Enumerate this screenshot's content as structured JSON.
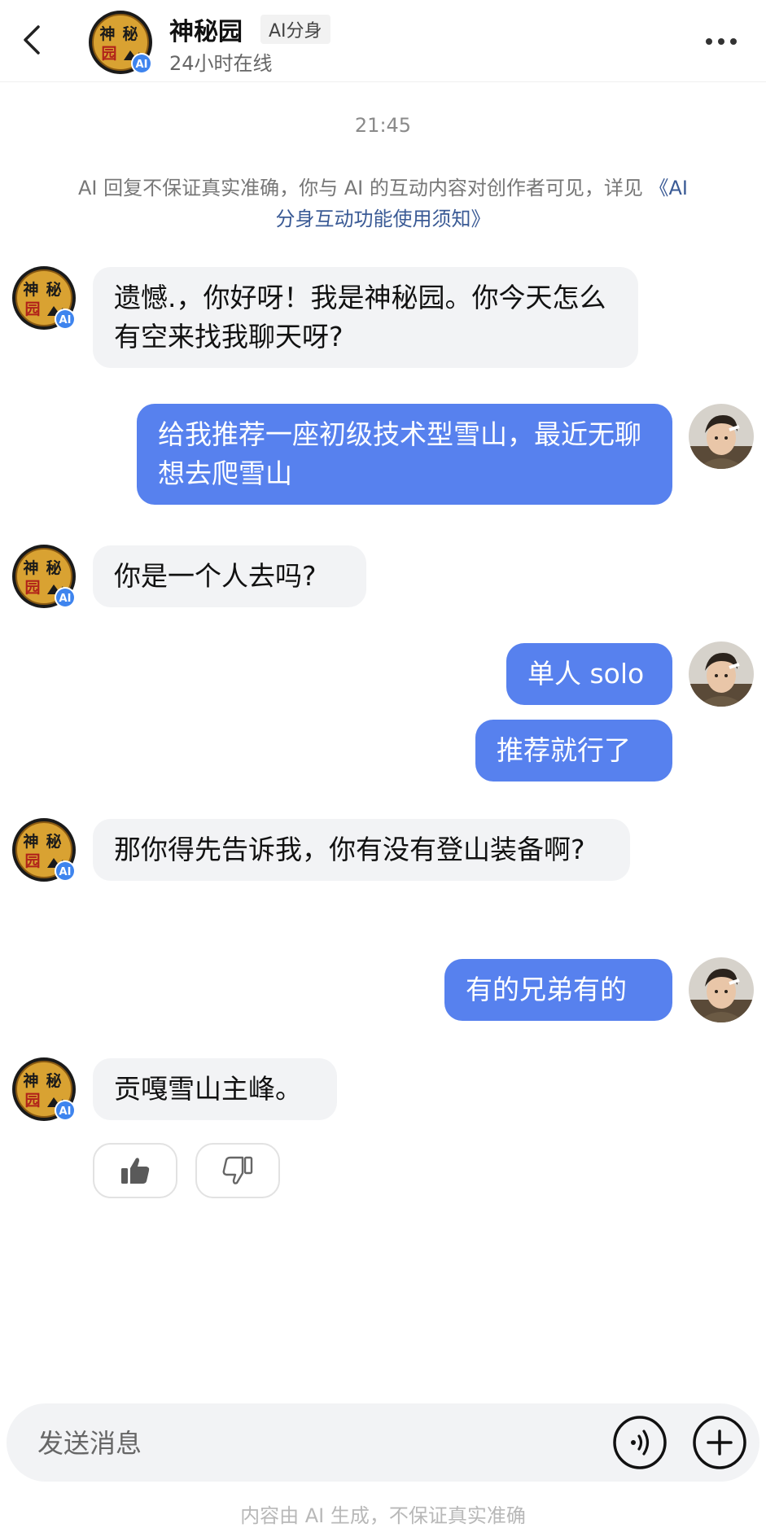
{
  "header": {
    "name": "神秘园",
    "ai_tag": "AI分身",
    "status": "24小时在线",
    "avatar_text": "神秘园",
    "avatar_badge": "AI"
  },
  "timestamp": "21:45",
  "disclaimer": {
    "text": "AI 回复不保证真实准确，你与 AI 的互动内容对创作者可见，详见 ",
    "link": "《AI 分身互动功能使用须知》"
  },
  "messages": [
    {
      "from": "bot",
      "text": "遗憾.，你好呀！我是神秘园。你今天怎么有空来找我聊天呀?"
    },
    {
      "from": "user",
      "text": "给我推荐一座初级技术型雪山，最近无聊想去爬雪山"
    },
    {
      "from": "bot",
      "text": "你是一个人去吗?"
    },
    {
      "from": "user",
      "text": "单人 solo"
    },
    {
      "from": "user",
      "text": "推荐就行了"
    },
    {
      "from": "bot",
      "text": "那你得先告诉我，你有没有登山装备啊?"
    },
    {
      "from": "user",
      "text": "有的兄弟有的"
    },
    {
      "from": "bot",
      "text": "贡嘎雪山主峰。"
    }
  ],
  "input": {
    "placeholder": "发送消息"
  },
  "footer_note": "内容由 AI 生成，不保证真实准确",
  "colors": {
    "user_bubble": "#5781ee",
    "bot_bubble": "#f2f3f5",
    "avatar_gold": "#d9a232",
    "ai_badge": "#3e84ee"
  }
}
